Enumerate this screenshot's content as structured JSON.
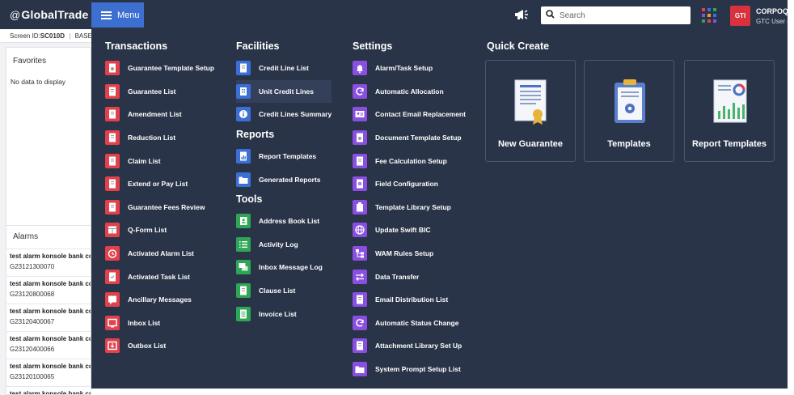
{
  "brand": {
    "prefix": "@",
    "name": "GlobalTrade"
  },
  "header": {
    "menu_label": "Menu",
    "search_placeholder": "Search",
    "avatar_initials": "GTI",
    "user_name": "CORPOQ",
    "user_role": "GTC User ("
  },
  "left": {
    "screen_id_label": "Screen ID:",
    "screen_id_value": "SC010D",
    "screen_id_sep": "|",
    "screen_id_path": "BASE > M",
    "favorites_title": "Favorites",
    "favorites_empty": "No data to display",
    "alarms_title": "Alarms",
    "alarms": [
      {
        "title": "test alarm konsole bank cor",
        "number": "G23121300070"
      },
      {
        "title": "test alarm konsole bank cor",
        "number": "G23120800068"
      },
      {
        "title": "test alarm konsole bank cor",
        "number": "G23120400067"
      },
      {
        "title": "test alarm konsole bank cor",
        "number": "G23120400066"
      },
      {
        "title": "test alarm konsole bank cor",
        "number": "G23120100065"
      },
      {
        "title": "test alarm konsole bank cor",
        "number": ""
      }
    ]
  },
  "menu": {
    "transactions": {
      "title": "Transactions",
      "items": [
        {
          "label": "Guarantee Template Setup",
          "icon": "template-doc-icon",
          "color": "#e0414d"
        },
        {
          "label": "Guarantee List",
          "icon": "document-list-icon",
          "color": "#e0414d"
        },
        {
          "label": "Amendment List",
          "icon": "document-list-icon",
          "color": "#e0414d"
        },
        {
          "label": "Reduction List",
          "icon": "document-list-icon",
          "color": "#e0414d"
        },
        {
          "label": "Claim List",
          "icon": "document-list-icon",
          "color": "#e0414d"
        },
        {
          "label": "Extend or Pay List",
          "icon": "document-list-icon",
          "color": "#e0414d"
        },
        {
          "label": "Guarantee Fees Review",
          "icon": "document-list-icon",
          "color": "#e0414d"
        },
        {
          "label": "Q-Form List",
          "icon": "table-icon",
          "color": "#e0414d"
        },
        {
          "label": "Activated Alarm List",
          "icon": "alarm-clock-icon",
          "color": "#e0414d"
        },
        {
          "label": "Activated Task List",
          "icon": "task-doc-icon",
          "color": "#e0414d"
        },
        {
          "label": "Ancillary Messages",
          "icon": "message-icon",
          "color": "#e0414d"
        },
        {
          "label": "Inbox List",
          "icon": "inbox-icon",
          "color": "#e0414d"
        },
        {
          "label": "Outbox List",
          "icon": "outbox-icon",
          "color": "#e0414d"
        }
      ]
    },
    "facilities": {
      "title": "Facilities",
      "items": [
        {
          "label": "Credit Line List",
          "icon": "document-list-icon",
          "color": "#3c6fd6"
        },
        {
          "label": "Unit Credit Lines",
          "icon": "building-icon",
          "color": "#3c6fd6"
        },
        {
          "label": "Credit Lines Summary",
          "icon": "info-icon",
          "color": "#3c6fd6"
        }
      ]
    },
    "reports": {
      "title": "Reports",
      "items": [
        {
          "label": "Report Templates",
          "icon": "chart-doc-icon",
          "color": "#3c6fd6"
        },
        {
          "label": "Generated Reports",
          "icon": "folder-icon",
          "color": "#3c6fd6"
        }
      ]
    },
    "tools": {
      "title": "Tools",
      "items": [
        {
          "label": "Address Book List",
          "icon": "address-book-icon",
          "color": "#2ea655"
        },
        {
          "label": "Activity Log",
          "icon": "list-icon",
          "color": "#2ea655"
        },
        {
          "label": "Inbox Message Log",
          "icon": "chat-icon",
          "color": "#2ea655"
        },
        {
          "label": "Clause List",
          "icon": "document-list-icon",
          "color": "#2ea655"
        },
        {
          "label": "Invoice List",
          "icon": "invoice-icon",
          "color": "#2ea655"
        }
      ]
    },
    "settings": {
      "title": "Settings",
      "items": [
        {
          "label": "Alarm/Task Setup",
          "icon": "alarm-bell-icon",
          "color": "#8a4fe0"
        },
        {
          "label": "Automatic Allocation",
          "icon": "refresh-icon",
          "color": "#8a4fe0"
        },
        {
          "label": "Contact Email Replacement",
          "icon": "contact-card-icon",
          "color": "#8a4fe0"
        },
        {
          "label": "Document Template Setup",
          "icon": "template-doc-icon",
          "color": "#8a4fe0"
        },
        {
          "label": "Fee Calculation Setup",
          "icon": "document-list-icon",
          "color": "#8a4fe0"
        },
        {
          "label": "Field Configuration",
          "icon": "settings-doc-icon",
          "color": "#8a4fe0"
        },
        {
          "label": "Template Library Setup",
          "icon": "library-icon",
          "color": "#8a4fe0"
        },
        {
          "label": "Update Swift BIC",
          "icon": "globe-icon",
          "color": "#8a4fe0"
        },
        {
          "label": "WAM Rules Setup",
          "icon": "rules-tree-icon",
          "color": "#8a4fe0"
        },
        {
          "label": "Data Transfer",
          "icon": "transfer-arrows-icon",
          "color": "#8a4fe0"
        },
        {
          "label": "Email Distribution List",
          "icon": "document-list-icon",
          "color": "#8a4fe0"
        },
        {
          "label": "Automatic Status Change",
          "icon": "refresh-icon",
          "color": "#8a4fe0"
        },
        {
          "label": "Attachment Library Set Up",
          "icon": "document-list-icon",
          "color": "#8a4fe0"
        },
        {
          "label": "System Prompt Setup List",
          "icon": "folder-icon",
          "color": "#8a4fe0"
        }
      ]
    },
    "quick_create": {
      "title": "Quick Create",
      "cards": [
        {
          "label": "New Guarantee",
          "icon": "certificate-icon"
        },
        {
          "label": "Templates",
          "icon": "clipboard-gear-icon"
        },
        {
          "label": "Report Templates",
          "icon": "report-chart-icon"
        }
      ]
    }
  }
}
